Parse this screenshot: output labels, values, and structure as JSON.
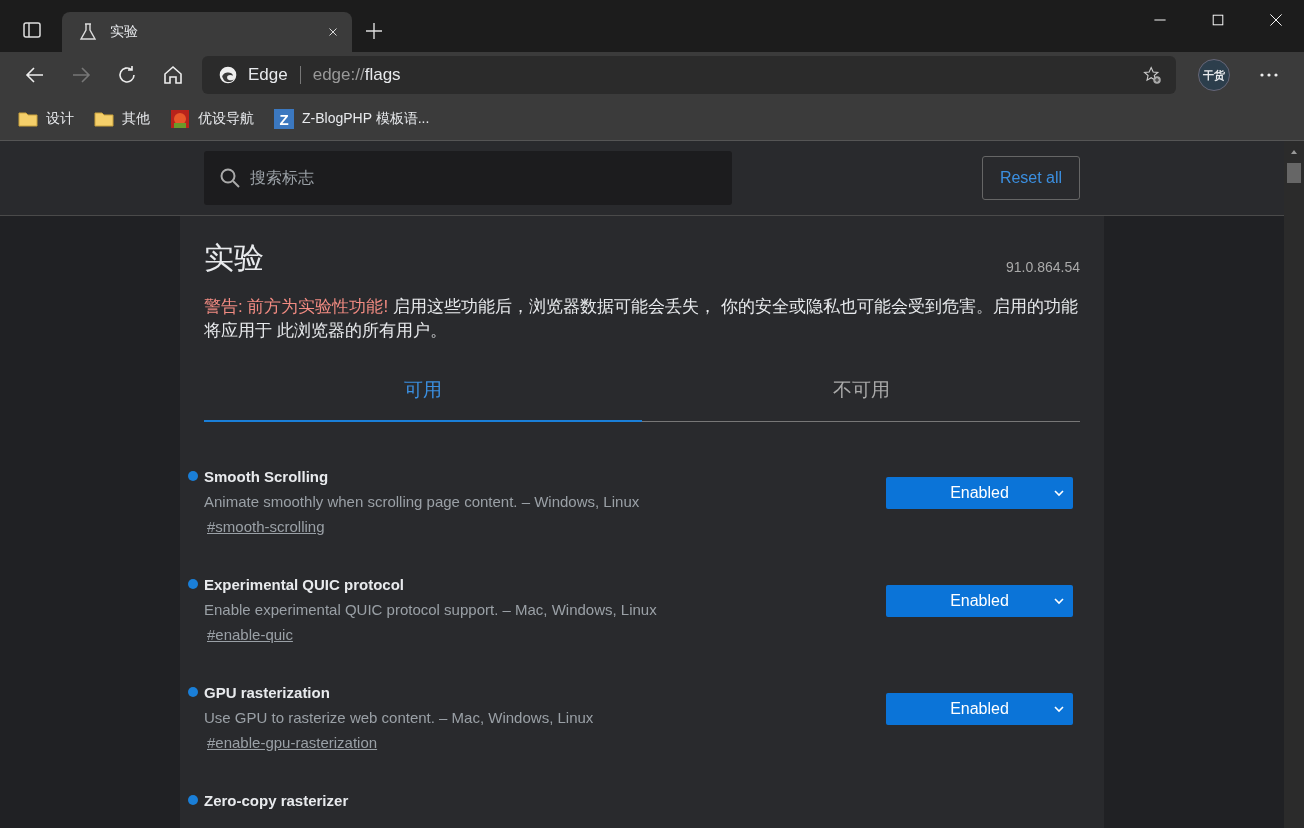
{
  "browser": {
    "tab": {
      "title": "实验"
    },
    "address": {
      "site": "Edge",
      "url_prefix": "edge://",
      "url_path": "flags"
    },
    "profile": {
      "label": "干货"
    },
    "bookmarks": [
      {
        "kind": "folder",
        "label": "设计"
      },
      {
        "kind": "folder",
        "label": "其他"
      },
      {
        "kind": "site",
        "label": "优设导航"
      },
      {
        "kind": "letter",
        "glyph": "Z",
        "label": "Z-BlogPHP 模板语..."
      }
    ]
  },
  "search": {
    "placeholder": "搜索标志"
  },
  "reset_button": "Reset all",
  "page": {
    "title": "实验",
    "version": "91.0.864.54",
    "warning_lead": "警告: 前方为实验性功能!",
    "warning_text": " 启用这些功能后，浏览器数据可能会丢失， 你的安全或隐私也可能会受到危害。启用的功能将应用于 此浏览器的所有用户。"
  },
  "tabs": [
    {
      "label": "可用",
      "selected": true
    },
    {
      "label": "不可用",
      "selected": false
    }
  ],
  "flags": [
    {
      "name": "Smooth Scrolling",
      "modified": true,
      "description": "Animate smoothly when scrolling page content. – Windows, Linux",
      "link": "#smooth-scrolling",
      "value": "Enabled"
    },
    {
      "name": "Experimental QUIC protocol",
      "modified": true,
      "description": "Enable experimental QUIC protocol support. – Mac, Windows, Linux",
      "link": "#enable-quic",
      "value": "Enabled"
    },
    {
      "name": "GPU rasterization",
      "modified": true,
      "description": "Use GPU to rasterize web content. – Mac, Windows, Linux",
      "link": "#enable-gpu-rasterization",
      "value": "Enabled"
    },
    {
      "name": "Zero-copy rasterizer",
      "modified": true
    }
  ]
}
